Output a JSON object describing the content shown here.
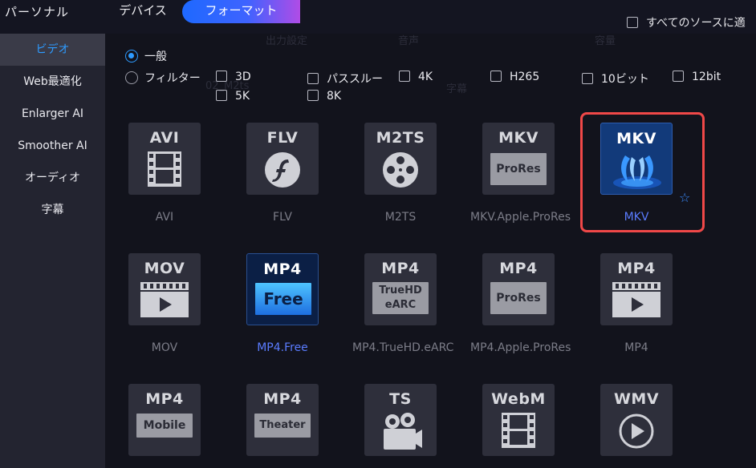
{
  "topbar": {
    "left_label": "パーソナル",
    "tab_device": "デバイス",
    "tab_format": "フォーマット",
    "all_sources": "すべてのソースに適"
  },
  "sidebar": {
    "items": [
      {
        "label": "ビデオ",
        "active": true
      },
      {
        "label": "Web最適化"
      },
      {
        "label": "Enlarger AI"
      },
      {
        "label": "Smoother AI"
      },
      {
        "label": "オーディオ"
      },
      {
        "label": "字幕"
      }
    ]
  },
  "options": {
    "general": "一般",
    "filter": "フィルター",
    "filters": [
      "3D",
      "パススルー",
      "4K",
      "H265",
      "10ビット",
      "12bit",
      "5K",
      "8K"
    ]
  },
  "background_hint": {
    "a": "出力設定",
    "b": "02_M2ts",
    "c": "字幕",
    "d": "音声",
    "e": "容量"
  },
  "formats": [
    {
      "title": "AVI",
      "label": "AVI",
      "icon": "film-strip-icon"
    },
    {
      "title": "FLV",
      "label": "FLV",
      "icon": "flash-icon"
    },
    {
      "title": "M2TS",
      "label": "M2TS",
      "icon": "film-reel-icon"
    },
    {
      "title": "MKV",
      "sub": "ProRes",
      "label": "MKV.Apple.ProRes",
      "icon": "prores-badge-icon"
    },
    {
      "title": "MKV",
      "label": "MKV",
      "icon": "mkv-matroska-icon",
      "selected": true
    },
    {
      "title": "MOV",
      "label": "MOV",
      "icon": "clapper-play-icon"
    },
    {
      "title": "MP4",
      "sub": "Free",
      "label": "MP4.Free",
      "icon": "free-badge-icon",
      "highlight": true
    },
    {
      "title": "MP4",
      "sub": "TrueHD\neARC",
      "label": "MP4.TrueHD.eARC",
      "icon": "truehd-badge-icon"
    },
    {
      "title": "MP4",
      "sub": "ProRes",
      "label": "MP4.Apple.ProRes",
      "icon": "prores-badge-icon"
    },
    {
      "title": "MP4",
      "label": "MP4",
      "icon": "clapper-play-icon"
    },
    {
      "title": "MP4",
      "sub": "Mobile",
      "label": "",
      "icon": "mobile-badge-icon"
    },
    {
      "title": "MP4",
      "sub": "Theater",
      "label": "",
      "icon": "theater-badge-icon"
    },
    {
      "title": "TS",
      "label": "",
      "icon": "camera-icon"
    },
    {
      "title": "WebM",
      "label": "",
      "icon": "film-strip-icon"
    },
    {
      "title": "WMV",
      "label": "",
      "icon": "play-circle-icon"
    }
  ],
  "colors": {
    "accent_blue": "#2e9bff",
    "selection_red": "#f04848",
    "gradient": [
      "#1e69ff",
      "#b04ce6"
    ]
  }
}
